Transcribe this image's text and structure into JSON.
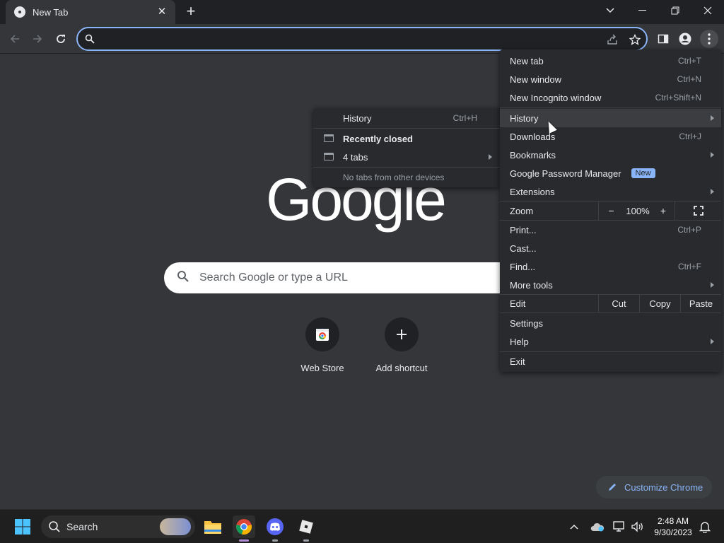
{
  "tab": {
    "title": "New Tab"
  },
  "omnibox": {
    "value": "",
    "placeholder": ""
  },
  "ntp": {
    "logo": "Google",
    "search_placeholder": "Search Google or type a URL",
    "shortcuts": [
      {
        "label": "Web Store"
      },
      {
        "label": "Add shortcut"
      }
    ],
    "customize_label": "Customize Chrome"
  },
  "menu": {
    "items": [
      {
        "label": "New tab",
        "shortcut": "Ctrl+T"
      },
      {
        "label": "New window",
        "shortcut": "Ctrl+N"
      },
      {
        "label": "New Incognito window",
        "shortcut": "Ctrl+Shift+N"
      },
      {
        "label": "History",
        "shortcut": ""
      },
      {
        "label": "Downloads",
        "shortcut": "Ctrl+J"
      },
      {
        "label": "Bookmarks",
        "shortcut": ""
      },
      {
        "label": "Google Password Manager",
        "badge": "New"
      },
      {
        "label": "Extensions",
        "shortcut": ""
      },
      {
        "label": "Print...",
        "shortcut": "Ctrl+P"
      },
      {
        "label": "Cast...",
        "shortcut": ""
      },
      {
        "label": "Find...",
        "shortcut": "Ctrl+F"
      },
      {
        "label": "More tools",
        "shortcut": ""
      },
      {
        "label": "Settings",
        "shortcut": ""
      },
      {
        "label": "Help",
        "shortcut": ""
      },
      {
        "label": "Exit",
        "shortcut": ""
      }
    ],
    "zoom": {
      "label": "Zoom",
      "minus": "−",
      "value": "100%",
      "plus": "+"
    },
    "edit": {
      "label": "Edit",
      "cut": "Cut",
      "copy": "Copy",
      "paste": "Paste"
    }
  },
  "history_submenu": {
    "history": {
      "label": "History",
      "shortcut": "Ctrl+H"
    },
    "recently_closed": "Recently closed",
    "tabs_group": "4 tabs",
    "no_tabs": "No tabs from other devices"
  },
  "taskbar": {
    "search_label": "Search",
    "time": "2:48 AM",
    "date": "9/30/2023"
  },
  "colors": {
    "accent": "#8ab4f8",
    "menu_bg": "#292a2d",
    "page_bg": "#35363a",
    "frame_bg": "#202124"
  }
}
